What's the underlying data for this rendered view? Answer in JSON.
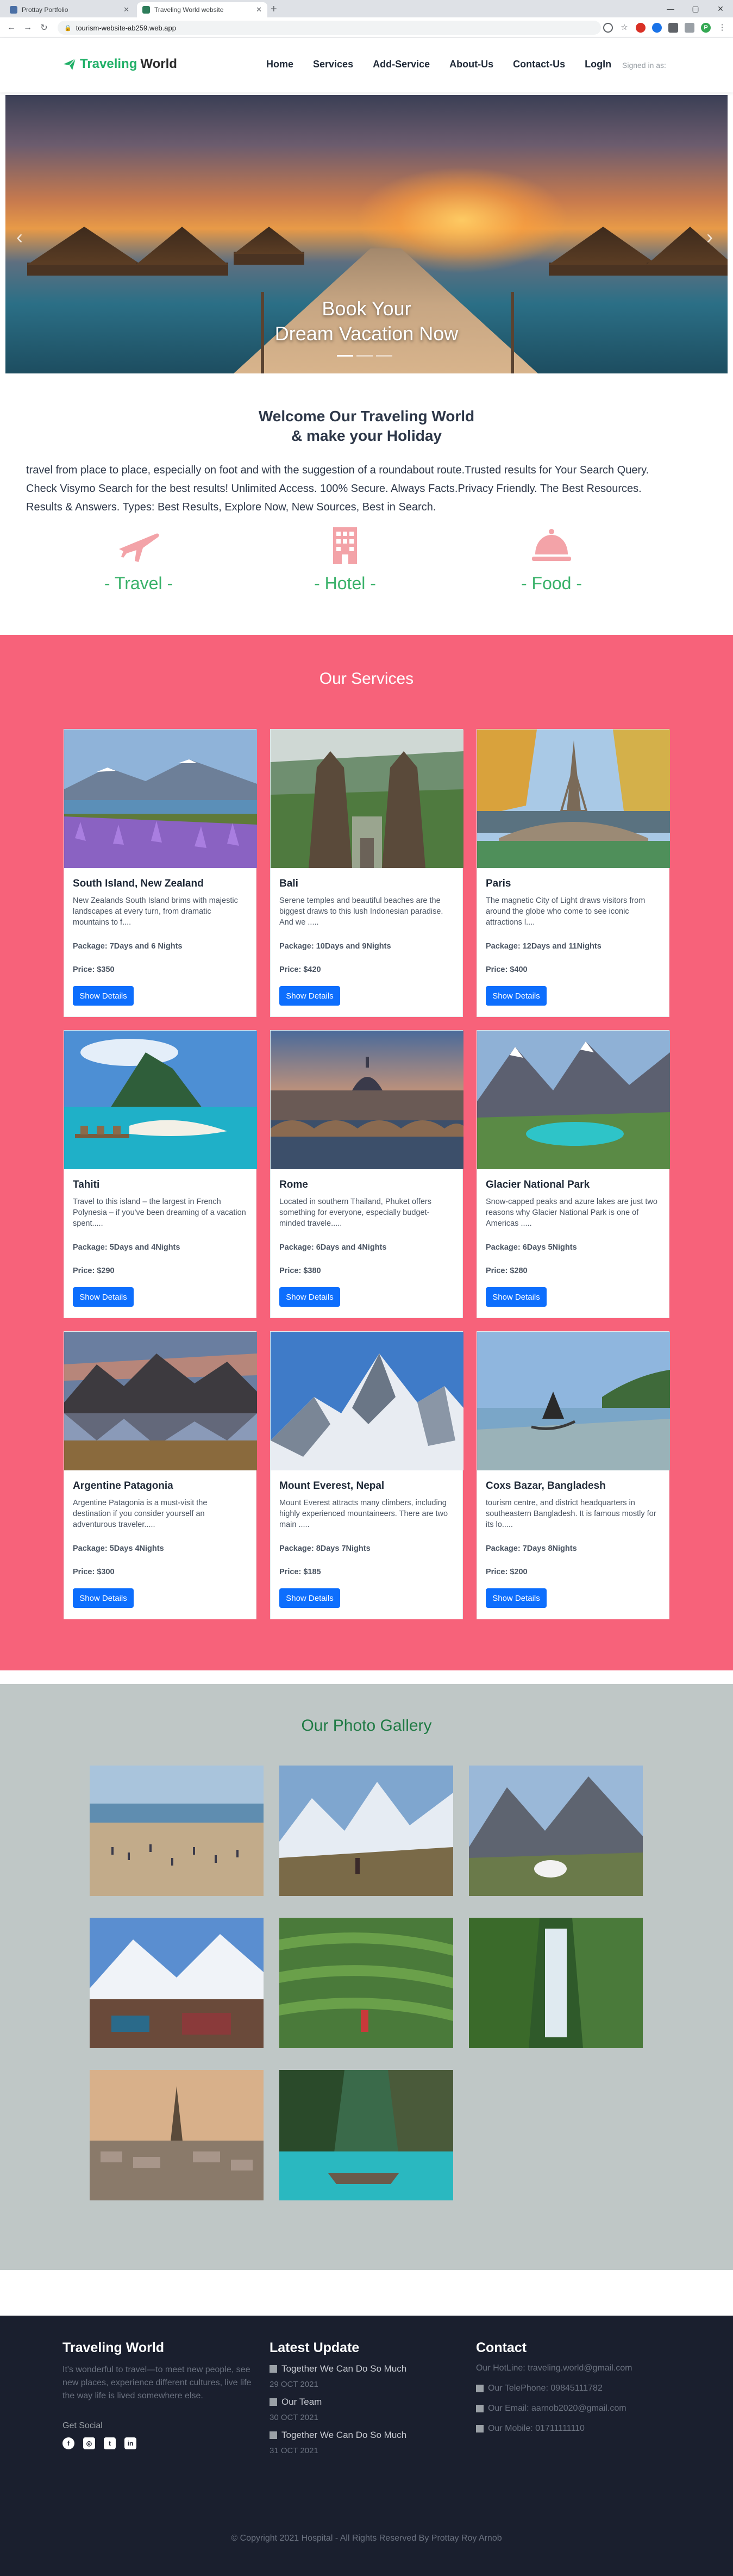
{
  "browser": {
    "tabs": [
      {
        "title": "Prottay Portfolio",
        "active": false
      },
      {
        "title": "Traveling World website",
        "active": true
      }
    ],
    "url": "tourism-website-ab259.web.app",
    "account_initial": "P"
  },
  "nav": {
    "brand_part1": "Traveling",
    "brand_part2": "World",
    "links": [
      "Home",
      "Services",
      "Add-Service",
      "About-Us",
      "Contact-Us",
      "LogIn"
    ],
    "signed_in": "Signed in as:"
  },
  "hero": {
    "title_line1": "Book Your",
    "title_line2": "Dream Vacation Now"
  },
  "welcome": {
    "title_line1": "Welcome Our Traveling World",
    "title_line2": "& make your Holiday",
    "text": "travel from place to place, especially on foot and with the suggestion of a roundabout route.Trusted results for Your Search Query. Check Visymo Search for the best results! Unlimited Access. 100% Secure. Always Facts.Privacy Friendly. The Best Resources. Results & Answers. Types: Best Results, Explore Now, New Sources, Best in Search.",
    "features": [
      {
        "label": "- Travel -",
        "icon": "plane-icon"
      },
      {
        "label": "- Hotel -",
        "icon": "hotel-icon"
      },
      {
        "label": "- Food -",
        "icon": "food-bell-icon"
      }
    ]
  },
  "services": {
    "title": "Our Services",
    "button_label": "Show Details",
    "cards": [
      {
        "title": "South Island, New Zealand",
        "desc": "New Zealands South Island brims with majestic landscapes at every turn, from dramatic mountains to f....",
        "package": "Package: 7Days and 6 Nights",
        "price": "Price: $350"
      },
      {
        "title": "Bali",
        "desc": "Serene temples and beautiful beaches are the biggest draws to this lush Indonesian paradise. And we .....",
        "package": "Package: 10Days and 9Nights",
        "price": "Price: $420"
      },
      {
        "title": "Paris",
        "desc": "The magnetic City of Light draws visitors from around the globe who come to see iconic attractions l....",
        "package": "Package: 12Days and 11Nights",
        "price": "Price: $400"
      },
      {
        "title": "Tahiti",
        "desc": "Travel to this island – the largest in French Polynesia – if you've been dreaming of a vacation spent.....",
        "package": "Package: 5Days and 4Nights",
        "price": "Price: $290"
      },
      {
        "title": "Rome",
        "desc": "Located in southern Thailand, Phuket offers something for everyone, especially budget-minded travele.....",
        "package": "Package: 6Days and 4Nights",
        "price": "Price: $380"
      },
      {
        "title": "Glacier National Park",
        "desc": "Snow-capped peaks and azure lakes are just two reasons why Glacier National Park is one of Americas .....",
        "package": "Package: 6Days 5Nights",
        "price": "Price: $280"
      },
      {
        "title": "Argentine Patagonia",
        "desc": "Argentine Patagonia is a must-visit the destination if you consider yourself an adventurous traveler.....",
        "package": "Package: 5Days 4Nights",
        "price": "Price: $300"
      },
      {
        "title": "Mount Everest, Nepal",
        "desc": "Mount Everest attracts many climbers, including highly experienced mountaineers. There are two main .....",
        "package": "Package: 8Days 7Nights",
        "price": "Price: $185"
      },
      {
        "title": "Coxs Bazar, Bangladesh",
        "desc": "tourism centre, and district headquarters in southeastern Bangladesh. It is famous mostly for its lo.....",
        "package": "Package: 7Days 8Nights",
        "price": "Price: $200"
      }
    ]
  },
  "gallery": {
    "title": "Our Photo Gallery"
  },
  "footer": {
    "about_title": "Traveling World",
    "about_text": "It's wonderful to travel—to meet new people, see new places, experience different cultures, live life the way life is lived somewhere else.",
    "social_label": "Get Social",
    "update_title": "Latest Update",
    "updates": [
      {
        "title": "Together We Can Do So Much",
        "date": "29 OCT 2021"
      },
      {
        "title": "Our Team",
        "date": "30 OCT 2021"
      },
      {
        "title": "Together We Can Do So Much",
        "date": "31 OCT 2021"
      }
    ],
    "contact_title": "Contact",
    "contacts": [
      "Our HotLine: traveling.world@gmail.com",
      "Our TelePhone: 09845111782",
      "Our Email: aarnob2020@gmail.com",
      "Our Mobile: 01711111110"
    ],
    "copyright": "© Copyright 2021 Hospital - All Rights Reserved By Prottay Roy Arnob"
  }
}
